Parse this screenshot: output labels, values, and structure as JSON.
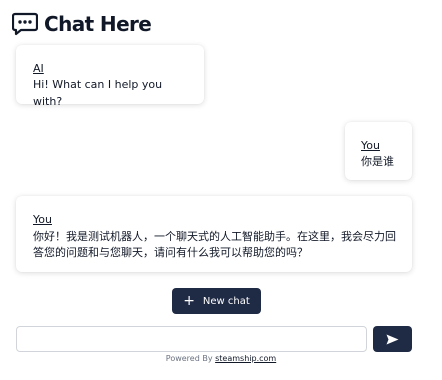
{
  "header": {
    "title": "Chat Here",
    "icon": "chat-bubble-dots-icon"
  },
  "messages": [
    {
      "sender": "AI",
      "text": "Hi! What can I help you with?"
    },
    {
      "sender": "You",
      "text": "你是谁"
    },
    {
      "sender": "AI",
      "display_sender": "You",
      "text": "你好！我是测试机器人，一个聊天式的人工智能助手。在这里，我会尽力回答您的问题和与您聊天，请问有什么我可以帮助您的吗？"
    }
  ],
  "controls": {
    "new_chat_label": "New chat",
    "new_chat_icon": "plus-icon",
    "input_value": "",
    "input_placeholder": "",
    "send_icon": "send-arrow-icon"
  },
  "footer": {
    "prefix": "Powered By ",
    "link_text": "steamship.com"
  },
  "colors": {
    "primary": "#1f2a44",
    "text": "#111827",
    "muted": "#6b7280",
    "border": "#d1d5db"
  }
}
